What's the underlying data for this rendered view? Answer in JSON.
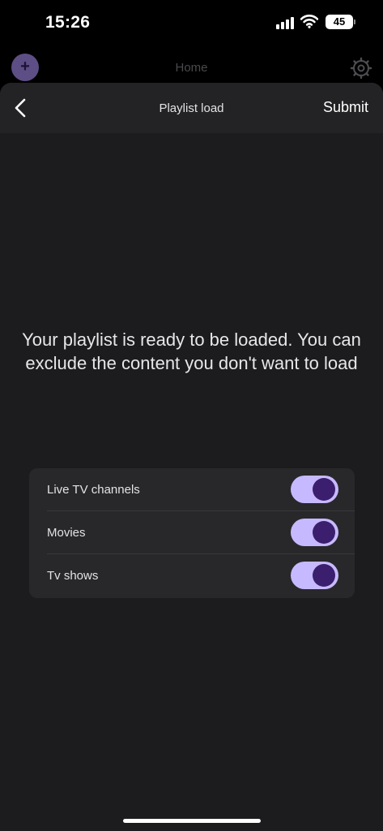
{
  "status_bar": {
    "time": "15:26",
    "battery": "45"
  },
  "background": {
    "title": "Home",
    "add_label": "+"
  },
  "nav": {
    "title": "Playlist load",
    "submit_label": "Submit"
  },
  "message": "Your playlist is ready to be loaded. You can exclude the content you don't want to load",
  "options": [
    {
      "label": "Live TV channels",
      "enabled": true
    },
    {
      "label": "Movies",
      "enabled": true
    },
    {
      "label": "Tv shows",
      "enabled": true
    }
  ],
  "colors": {
    "accent": "#c7b9ff",
    "knob": "#3b1f6e",
    "sheet": "#1c1c1e",
    "card": "#28282b"
  }
}
